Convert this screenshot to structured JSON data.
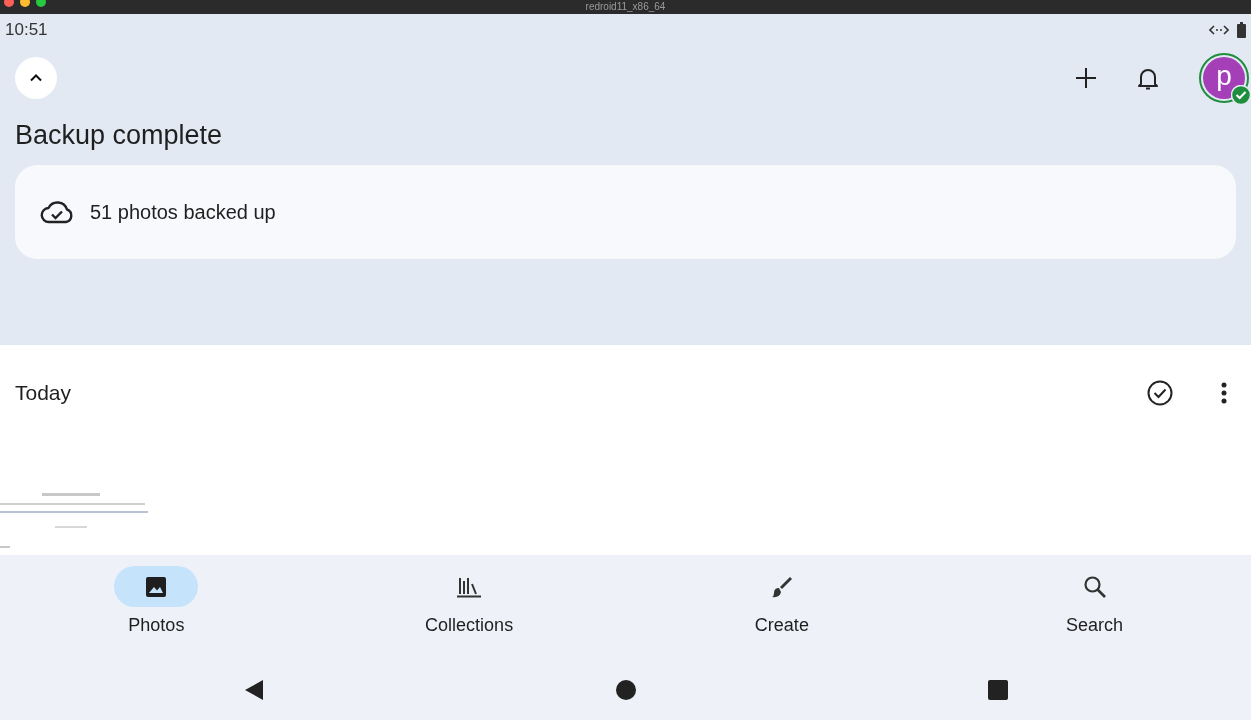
{
  "window": {
    "title": "redroid11_x86_64"
  },
  "status_bar": {
    "time": "10:51"
  },
  "header": {
    "title": "Backup complete",
    "avatar_letter": "p",
    "backup_card": {
      "text": "51 photos backed up"
    }
  },
  "section": {
    "title": "Today"
  },
  "bottom_nav": [
    {
      "label": "Photos",
      "kind": "photos",
      "selected": true
    },
    {
      "label": "Collections",
      "kind": "collections",
      "selected": false
    },
    {
      "label": "Create",
      "kind": "create",
      "selected": false
    },
    {
      "label": "Search",
      "kind": "search",
      "selected": false
    }
  ]
}
